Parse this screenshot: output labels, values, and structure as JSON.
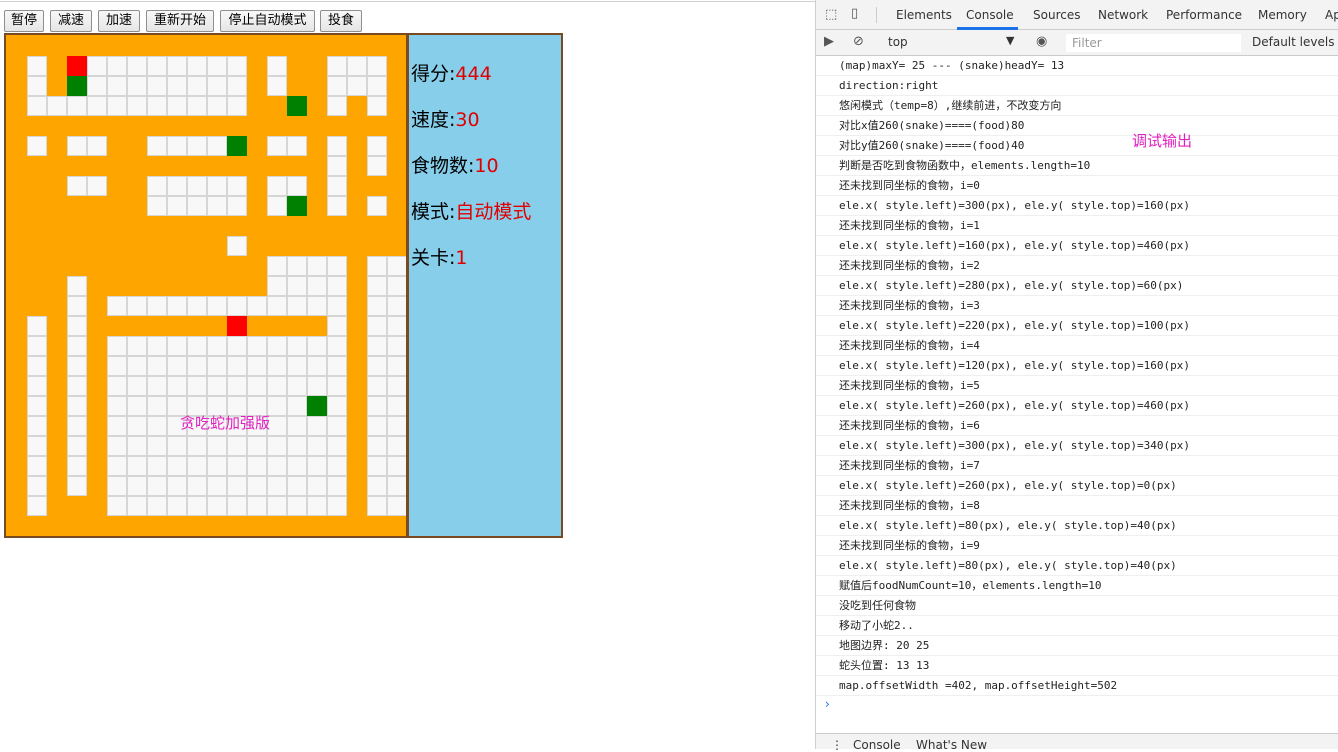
{
  "controls": {
    "pause": "暂停",
    "slow_down": "减速",
    "speed_up": "加速",
    "restart": "重新开始",
    "stop_auto": "停止自动模式",
    "feed": "投食"
  },
  "board": {
    "cols": 20,
    "rows": 25,
    "watermark": "贪吃蛇加强版",
    "legend": {
      "0": "snake-body",
      "1": "empty",
      "2": "food",
      "3": "snake-head"
    },
    "grid": [
      "00000000000000000000",
      "01031111111101001110",
      "01021111111101001110",
      "01111111111100201010",
      "00000000000000000000",
      "01011001111201101010",
      "00000000000000001010",
      "00011001111101101000",
      "00000001111101201010",
      "00000000000000000000",
      "00000000000100000000",
      "00000000000001111011",
      "00010000000001111011",
      "00010111111111111011",
      "01010000000300001011",
      "01010111111111111011",
      "01010111111111111011",
      "01010111111111111011",
      "01010111111111121011",
      "01010111111111111011",
      "01010111111111111011",
      "01010111111111111011",
      "01010111111111111011",
      "01000111111111111011",
      "00000000000000000000"
    ]
  },
  "stats": {
    "score_label": "得分:",
    "score": "444",
    "speed_label": "速度:",
    "speed": "30",
    "food_label": "食物数:",
    "food": "10",
    "mode_label": "模式:",
    "mode": "自动模式",
    "level_label": "关卡:",
    "level": "1"
  },
  "devtools": {
    "tabs": [
      "Elements",
      "Console",
      "Sources",
      "Network",
      "Performance",
      "Memory",
      "Ap"
    ],
    "active_tab": "Console",
    "context": "top",
    "filter_placeholder": "Filter",
    "levels": "Default levels ▼",
    "debug_label": "调试输出",
    "console_lines": [
      "(map)maxY= 25 --- (snake)headY= 13",
      "direction:right",
      "悠闲模式（temp=8）,继续前进，不改变方向",
      "对比x值260(snake)====(food)80",
      "对比y值260(snake)====(food)40",
      "判断是否吃到食物函数中，elements.length=10",
      "还未找到同坐标的食物，i=0",
      "ele.x( style.left)=300(px), ele.y( style.top)=160(px)",
      "还未找到同坐标的食物，i=1",
      "ele.x( style.left)=160(px), ele.y( style.top)=460(px)",
      "还未找到同坐标的食物，i=2",
      "ele.x( style.left)=280(px), ele.y( style.top)=60(px)",
      "还未找到同坐标的食物，i=3",
      "ele.x( style.left)=220(px), ele.y( style.top)=100(px)",
      "还未找到同坐标的食物，i=4",
      "ele.x( style.left)=120(px), ele.y( style.top)=160(px)",
      "还未找到同坐标的食物，i=5",
      "ele.x( style.left)=260(px), ele.y( style.top)=460(px)",
      "还未找到同坐标的食物，i=6",
      "ele.x( style.left)=300(px), ele.y( style.top)=340(px)",
      "还未找到同坐标的食物，i=7",
      "ele.x( style.left)=260(px), ele.y( style.top)=0(px)",
      "还未找到同坐标的食物，i=8",
      "ele.x( style.left)=80(px), ele.y( style.top)=40(px)",
      "还未找到同坐标的食物，i=9",
      "ele.x( style.left)=80(px), ele.y( style.top)=40(px)",
      "赋值后foodNumCount=10，elements.length=10",
      "没吃到任何食物",
      "移动了小蛇2..",
      "地图边界: 20 25",
      "蛇头位置: 13 13",
      "map.offsetWidth =402, map.offsetHeight=502"
    ],
    "drawer_tabs": [
      "Console",
      "What's New"
    ]
  }
}
